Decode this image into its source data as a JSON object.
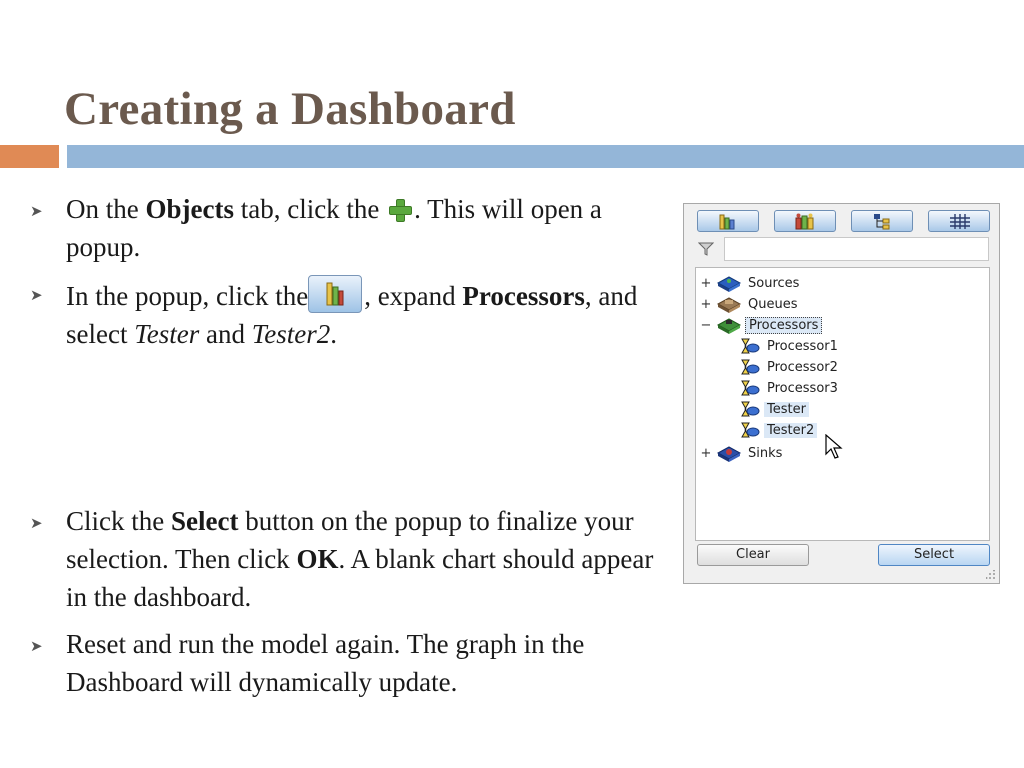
{
  "slide": {
    "title": "Creating a Dashboard"
  },
  "bullets": [
    {
      "t1": "On the ",
      "b1": "Objects",
      "t2": " tab, click the ",
      "t3": ". This will open a popup."
    },
    {
      "t1": "In the popup, click the",
      "t2": ", expand ",
      "b1": "Processors",
      "t3": ", and select ",
      "i1": "Tester",
      "t4": " and ",
      "i2": "Tester2",
      "t5": "."
    },
    {
      "t1": "Click the ",
      "b1": "Select",
      "t2": " button on the popup to finalize your selection. Then click ",
      "b2": "OK",
      "t3": ". A blank chart should appear in the dashboard."
    },
    {
      "t1": "Reset and run the model again. The graph in the Dashboard will dynamically update."
    }
  ],
  "popup": {
    "tree": {
      "sources": "Sources",
      "queues": "Queues",
      "processors": "Processors",
      "children": [
        "Processor1",
        "Processor2",
        "Processor3",
        "Tester",
        "Tester2"
      ],
      "sinks": "Sinks"
    },
    "filter_value": "",
    "clear_label": "Clear",
    "select_label": "Select"
  },
  "colors": {
    "title": "#6b5a4e",
    "accent_orange": "#e08a55",
    "accent_blue": "#94b6d8"
  }
}
